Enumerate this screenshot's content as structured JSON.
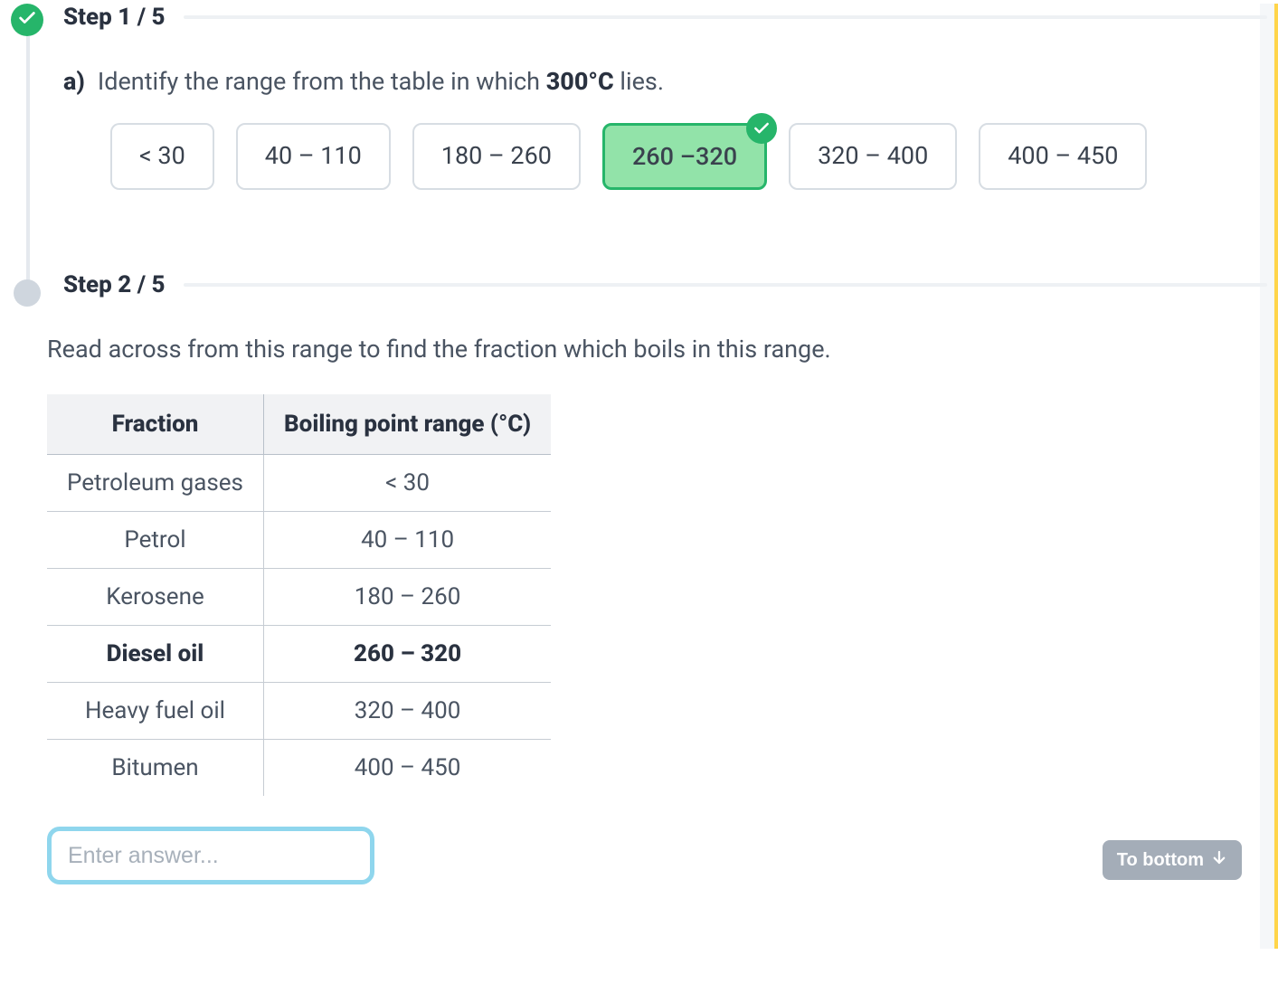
{
  "step1": {
    "header": "Step 1 / 5",
    "question_letter": "a)",
    "question_pre": "Identify the range from the table in which ",
    "question_bold": "300°C",
    "question_post": " lies.",
    "options": [
      {
        "label": "< 30"
      },
      {
        "label": "40 – 110"
      },
      {
        "label": "180 – 260"
      },
      {
        "label": "260 –320",
        "selected_correct": true
      },
      {
        "label": "320 – 400"
      },
      {
        "label": "400 – 450"
      }
    ]
  },
  "step2": {
    "header": "Step 2 / 5",
    "instruction": "Read across from this range to find the fraction which boils in this range.",
    "table": {
      "col1": "Fraction",
      "col2_pre": "Boiling point range (",
      "col2_unit": "°C",
      "col2_post": ")",
      "rows": [
        {
          "fraction": "Petroleum gases",
          "range": "< 30"
        },
        {
          "fraction": "Petrol",
          "range": "40 – 110"
        },
        {
          "fraction": "Kerosene",
          "range": "180 – 260"
        },
        {
          "fraction": "Diesel oil",
          "range": "260 – 320",
          "bold": true
        },
        {
          "fraction": "Heavy fuel oil",
          "range": "320 – 400"
        },
        {
          "fraction": "Bitumen",
          "range": "400 – 450"
        }
      ]
    },
    "answer_placeholder": "Enter answer..."
  },
  "to_bottom_label": "To bottom"
}
